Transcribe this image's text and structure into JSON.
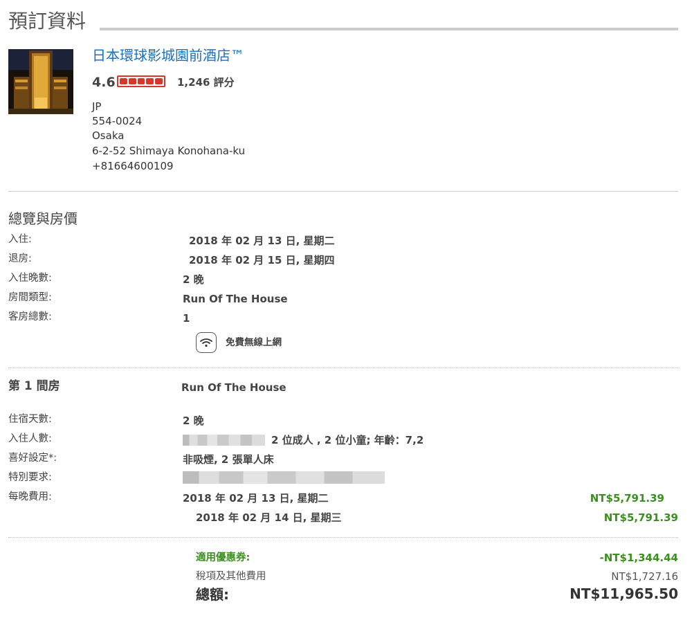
{
  "page": {
    "title": "預訂資料"
  },
  "hotel": {
    "name": "日本環球影城園前酒店™",
    "rating": "4.6",
    "rating_stars": 4.6,
    "rating_max": 5,
    "rating_color": "#d9362b",
    "reviews": "1,246 評分",
    "address": [
      "JP",
      "554-0024",
      "Osaka",
      "6-2-52 Shimaya Konohana-ku",
      "+81664600109"
    ]
  },
  "overview": {
    "title": "總覽與房價",
    "rows": [
      {
        "label": "入住:",
        "value": "2018 年 02 月 13 日, 星期二"
      },
      {
        "label": "退房:",
        "value": "2018 年 02 月 15 日, 星期四"
      },
      {
        "label": "入住晚數:",
        "value": "2 晚"
      },
      {
        "label": "房間類型:",
        "value": "Run Of The House"
      },
      {
        "label": "客房總數:",
        "value": "1"
      }
    ],
    "amenity": {
      "icon": "wifi-icon",
      "label": "免費無線上網"
    }
  },
  "room": {
    "title": "第 1 間房",
    "type": "Run Of The House",
    "nights_label": "住宿天數:",
    "nights": "2 晚",
    "guests_label": "入住人數:",
    "guests": "2 位成人 , 2 位小童;  年齡：7,2",
    "preference_label": "喜好設定*:",
    "preference": "非吸煙, 2 張單人床",
    "special_label": "特別要求:",
    "nightly_label": "每晚費用:",
    "nightly": [
      {
        "date": "2018 年 02 月 13 日, 星期二",
        "price": "NT$5,791.39"
      },
      {
        "date": "2018 年 02 月 14 日, 星期三",
        "price": "NT$5,791.39"
      }
    ]
  },
  "summary": {
    "coupon_label": "適用優惠券:",
    "coupon_value": "-NT$1,344.44",
    "tax_label": "稅項及其他費用",
    "tax_value": "NT$1,727.16",
    "total_label": "總額:",
    "total_value": "NT$11,965.50"
  },
  "colors": {
    "link": "#1a6fc0",
    "price": "#3a8f1e",
    "rating": "#d9362b"
  }
}
